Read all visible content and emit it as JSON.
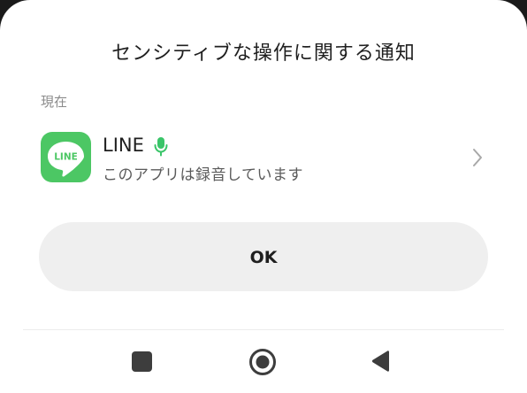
{
  "dialog": {
    "title": "センシティブな操作に関する通知",
    "section_label": "現在",
    "app": {
      "icon": "line-app-icon",
      "icon_text": "LINE",
      "name": "LINE",
      "status": "このアプリは録音しています",
      "indicator_icon": "microphone-icon",
      "indicator_color": "#3ac569"
    },
    "ok_label": "OK"
  },
  "navbar": {
    "recents_icon": "square-icon",
    "home_icon": "circle-home-icon",
    "back_icon": "triangle-back-icon"
  },
  "colors": {
    "line_green": "#4cc764",
    "button_bg": "#efefef",
    "background": "#ffffff"
  }
}
